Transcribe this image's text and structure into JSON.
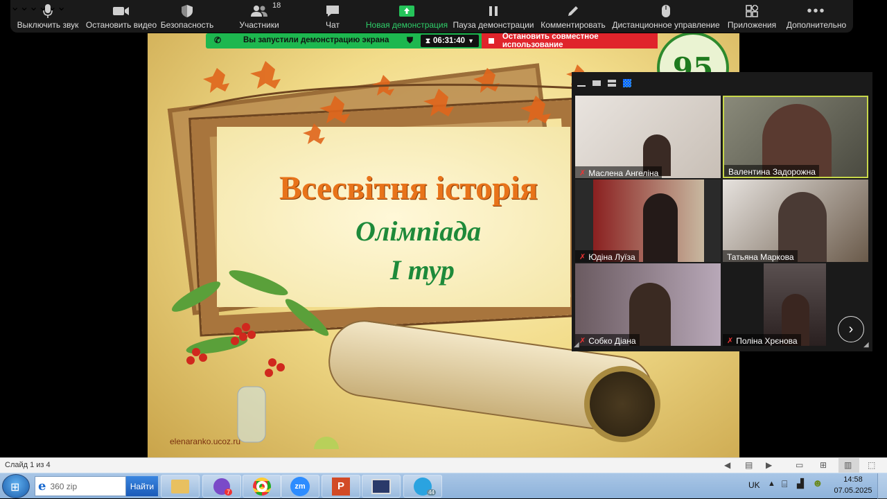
{
  "toolbar": {
    "mute": "Выключить звук",
    "video": "Остановить видео",
    "security": "Безопасность",
    "participants": "Участники",
    "participants_count": "18",
    "chat": "Чат",
    "new_share": "Новая демонстрация",
    "pause_share": "Пауза демонстрации",
    "annotate": "Комментировать",
    "remote": "Дистанционное управление",
    "apps": "Приложения",
    "more": "Дополнительно"
  },
  "share_banner": {
    "text": "Вы запустили демонстрацию экрана",
    "timer": "06:31:40",
    "stop": "Остановить совместное использование"
  },
  "slide": {
    "title": "Всесвітня історія",
    "subtitle": "Олімпіада",
    "round": "І тур",
    "credit": "elenaranko.ucoz.ru",
    "badge": "95"
  },
  "gallery": {
    "participants": [
      {
        "name": "Маслена Ангеліна",
        "muted": true
      },
      {
        "name": "Валентина Задорожна",
        "muted": false
      },
      {
        "name": "Юдіна Луїза",
        "muted": true
      },
      {
        "name": "Татьяна Маркова",
        "muted": false
      },
      {
        "name": "Собко Діана",
        "muted": true
      },
      {
        "name": "Поліна Хрєнова",
        "muted": true
      }
    ]
  },
  "ppt_status": {
    "slide_info": "Слайд 1 из 4"
  },
  "taskbar": {
    "search_value": "360 zip",
    "search_button": "Найти",
    "viber_badge": "7",
    "telegram_badge": "44",
    "lang": "UK",
    "time": "14:58",
    "date": "07.05.2025"
  },
  "colors": {
    "toolbar_bg": "#1a1a1a",
    "share_green": "#1db74f",
    "stop_red": "#e0242b",
    "title_orange": "#e8731a",
    "subtitle_green": "#1e8a3a"
  }
}
